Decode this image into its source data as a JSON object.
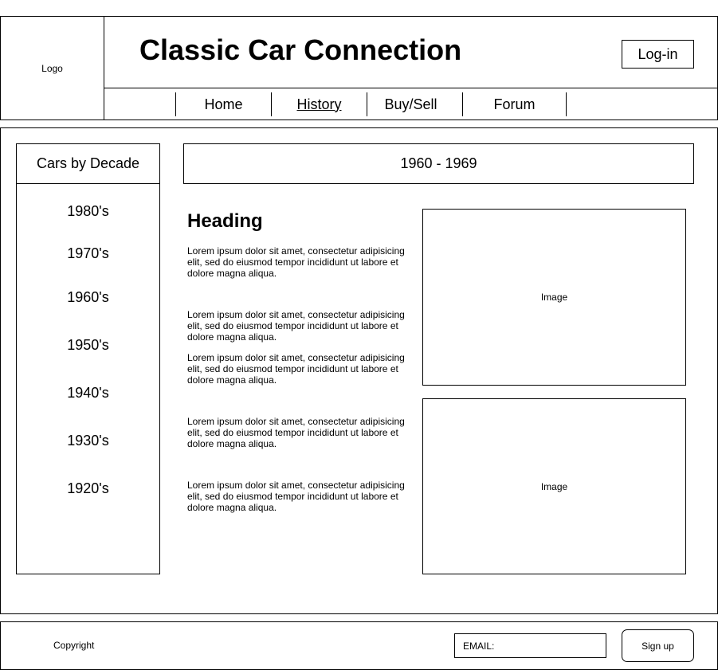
{
  "header": {
    "logo": "Logo",
    "title": "Classic Car Connection",
    "login_label": "Log-in",
    "nav": [
      "Home",
      "History",
      "Buy/Sell",
      "Forum"
    ]
  },
  "sidebar": {
    "title": "Cars by Decade",
    "decades": [
      "1980's",
      "1970's",
      "1960's",
      "1950's",
      "1940's",
      "1930's",
      "1920's"
    ]
  },
  "content": {
    "range_title": "1960 - 1969",
    "heading": "Heading",
    "paragraphs": [
      "Lorem ipsum dolor sit amet, consectetur adipisicing elit, sed do eiusmod tempor incididunt ut labore et dolore magna aliqua.",
      "Lorem ipsum dolor sit amet, consectetur adipisicing elit, sed do eiusmod tempor incididunt ut labore et dolore magna aliqua.",
      "Lorem ipsum dolor sit amet, consectetur adipisicing elit, sed do eiusmod tempor incididunt ut labore et dolore magna aliqua.",
      "Lorem ipsum dolor sit amet, consectetur adipisicing elit, sed do eiusmod tempor incididunt ut labore et dolore magna aliqua.",
      "Lorem ipsum dolor sit amet, consectetur adipisicing elit, sed do eiusmod tempor incididunt ut labore et dolore magna aliqua."
    ],
    "images": [
      "Image",
      "Image"
    ]
  },
  "footer": {
    "copyright": "Copyright",
    "email_placeholder": "EMAIL:",
    "signup_label": "Sign up"
  }
}
